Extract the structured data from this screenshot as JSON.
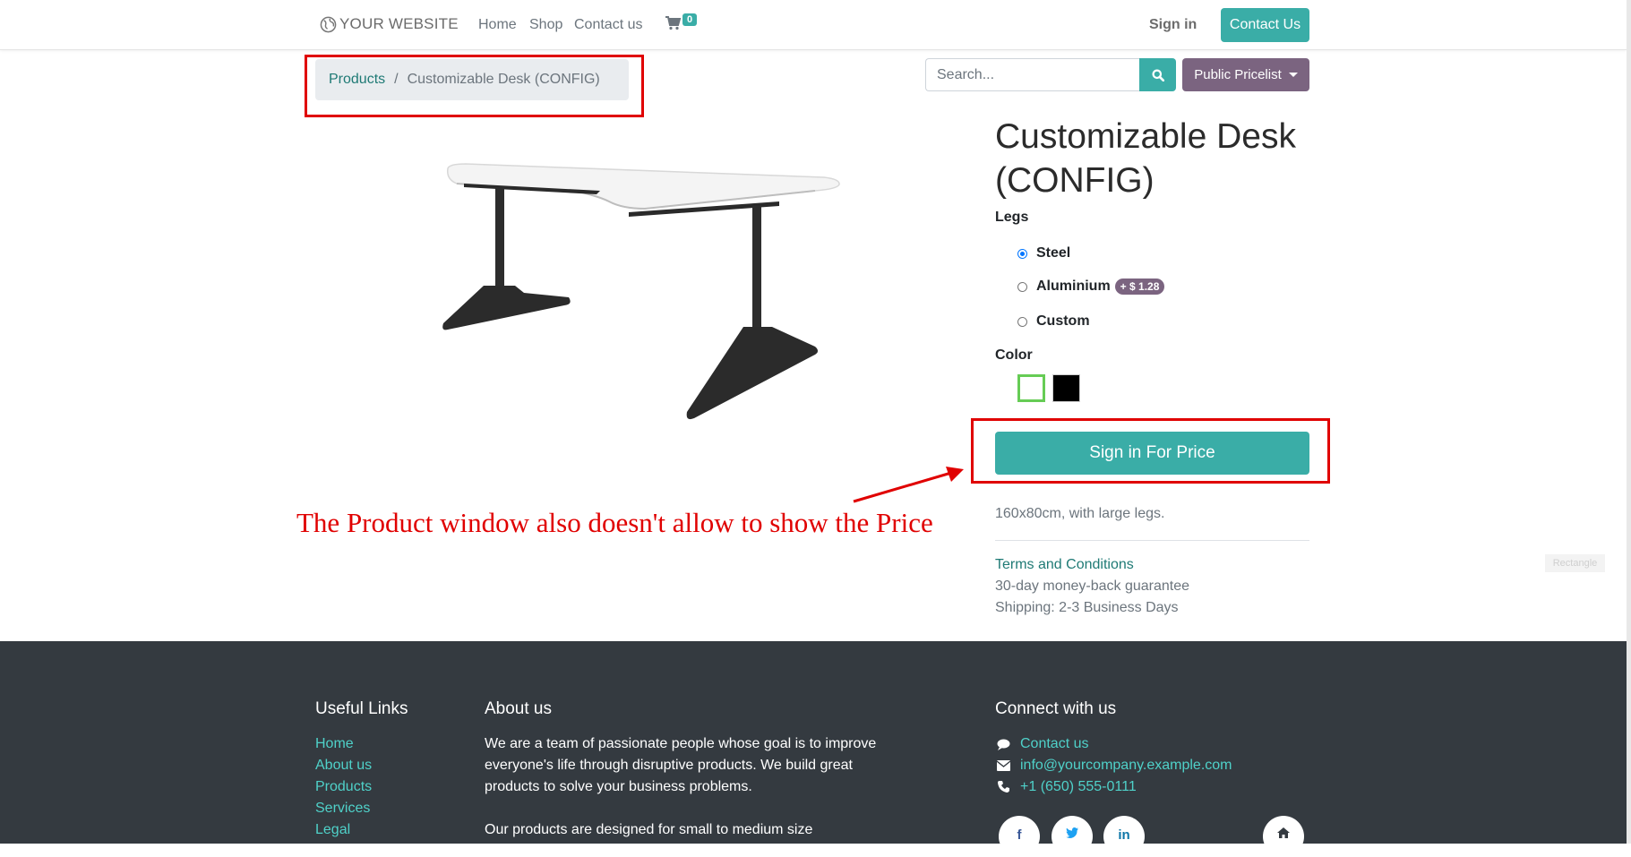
{
  "header": {
    "logo_text": "YOUR WEBSITE",
    "nav": [
      {
        "label": "Home"
      },
      {
        "label": "Shop"
      },
      {
        "label": "Contact us"
      }
    ],
    "cart_count": "0",
    "sign_in": "Sign in",
    "contact_button": "Contact Us"
  },
  "breadcrumb": {
    "parent": "Products",
    "separator": "/",
    "current": "Customizable Desk (CONFIG)"
  },
  "search": {
    "placeholder": "Search...",
    "pricelist_label": "Public Pricelist"
  },
  "product": {
    "title": "Customizable Desk (CONFIG)",
    "legs_label": "Legs",
    "legs_options": [
      {
        "label": "Steel",
        "selected": true
      },
      {
        "label": "Aluminium",
        "extra": "+ $ 1.28",
        "selected": false
      },
      {
        "label": "Custom",
        "selected": false
      }
    ],
    "color_label": "Color",
    "colors": [
      {
        "value": "#ffffff",
        "selected": true
      },
      {
        "value": "#000000",
        "selected": false
      }
    ],
    "sign_in_price_button": "Sign in For Price",
    "description": "160x80cm, with large legs.",
    "terms_link": "Terms and Conditions",
    "guarantee": "30-day money-back guarantee",
    "shipping": "Shipping: 2-3 Business Days"
  },
  "annotation": {
    "text": "The Product window also doesn't allow to show the Price",
    "color": "#e00000"
  },
  "overlay_tag": "Rectangle",
  "footer": {
    "useful_links_title": "Useful Links",
    "useful_links": [
      "Home",
      "About us",
      "Products",
      "Services",
      "Legal"
    ],
    "about_title": "About us",
    "about_text_1": "We are a team of passionate people whose goal is to improve everyone's life through disruptive products. We build great products to solve your business problems.",
    "about_text_2": "Our products are designed for small to medium size",
    "connect_title": "Connect with us",
    "contact_link": "Contact us",
    "email": "info@yourcompany.example.com",
    "phone": "+1 (650) 555-0111",
    "social_icons": [
      "facebook-icon",
      "twitter-icon",
      "linkedin-icon",
      "home-icon"
    ]
  },
  "colors": {
    "primary": "#3aada7",
    "secondary": "#7b6480",
    "footer_bg": "#343a40",
    "footer_link": "#4fd1c9"
  }
}
